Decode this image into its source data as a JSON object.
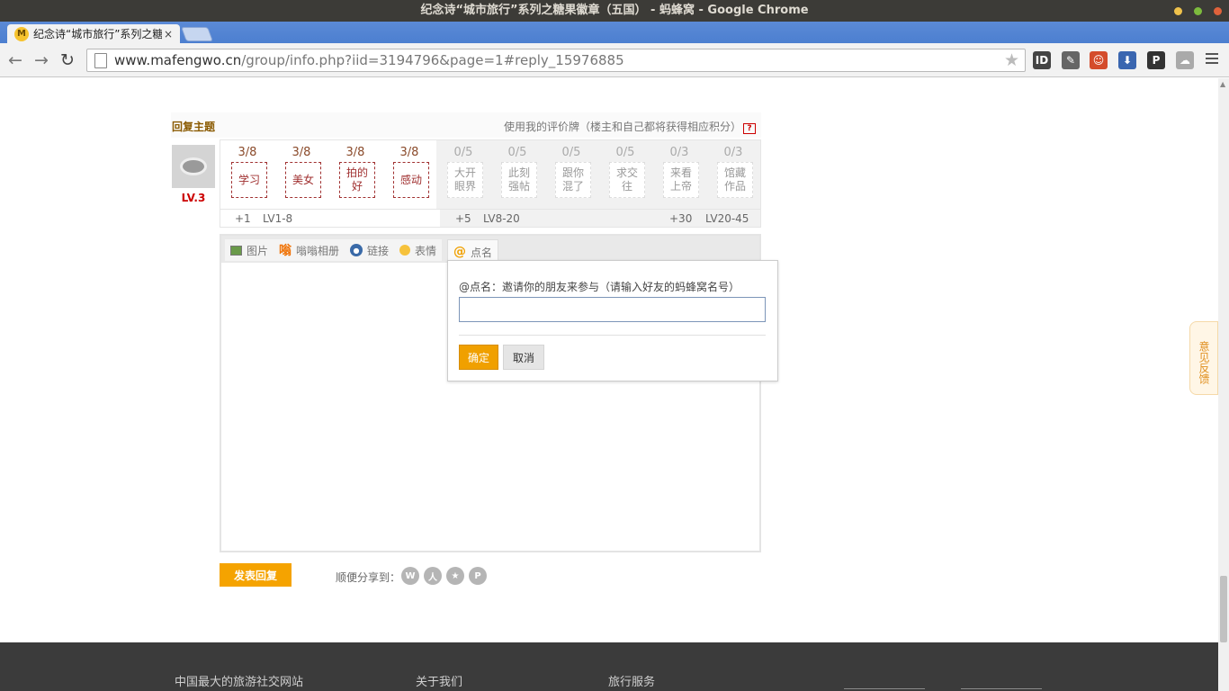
{
  "window": {
    "title": "纪念诗“城市旅行”系列之糖果徽章（五国） - 蚂蜂窝 - Google Chrome",
    "tab_title": "纪念诗“城市旅行”系列之糖",
    "tab_close": "×",
    "favicon_letter": "M"
  },
  "toolbar": {
    "url_host": "www.mafengwo.cn",
    "url_rest": "/group/info.php?iid=3194796&page=1#reply_15976885",
    "back": "←",
    "forward": "→",
    "reload": "↻",
    "star": "★",
    "extensions": [
      {
        "name": "readability-icon",
        "label": "ID",
        "color": "#444444"
      },
      {
        "name": "evernote-icon",
        "label": "✎",
        "color": "#666666"
      },
      {
        "name": "santa-icon",
        "label": "☺",
        "color": "#d44c2c"
      },
      {
        "name": "download-icon",
        "label": "⬇",
        "color": "#3a66b0"
      },
      {
        "name": "pocket-icon",
        "label": "P",
        "color": "#333333"
      },
      {
        "name": "ghost-icon",
        "label": "☁",
        "color": "#aaaaaa"
      }
    ]
  },
  "reply": {
    "heading": "回复主题",
    "rating_hint": "使用我的评价牌（楼主和自己都将获得相应积分）",
    "help_icon": "?",
    "user_level": "LV.3",
    "free_cards": [
      {
        "count": "3/8",
        "label": "学习"
      },
      {
        "count": "3/8",
        "label": "美女"
      },
      {
        "count": "3/8",
        "label": "拍的好"
      },
      {
        "count": "3/8",
        "label": "感动"
      }
    ],
    "locked_cards": [
      {
        "count": "0/5",
        "label": "大开眼界"
      },
      {
        "count": "0/5",
        "label": "此刻强帖"
      },
      {
        "count": "0/5",
        "label": "跟你混了"
      },
      {
        "count": "0/5",
        "label": "求交往"
      },
      {
        "count": "0/3",
        "label": "来看上帝"
      },
      {
        "count": "0/3",
        "label": "馆藏作品"
      }
    ],
    "tiers": [
      {
        "points": "+1",
        "levels": "LV1-8"
      },
      {
        "points": "+5",
        "levels": "LV8-20"
      },
      {
        "points": "+30",
        "levels": "LV20-45"
      }
    ]
  },
  "editor": {
    "tools": [
      {
        "name": "image",
        "label": "图片"
      },
      {
        "name": "album",
        "label": "嗡嗡相册"
      },
      {
        "name": "link",
        "label": "链接"
      },
      {
        "name": "emoji",
        "label": "表情"
      },
      {
        "name": "mention",
        "label": "点名"
      }
    ]
  },
  "mention_popup": {
    "title": "@点名：邀请你的朋友来参与（请输入好友的蚂蜂窝名号）",
    "input_value": "",
    "confirm": "确定",
    "cancel": "取消"
  },
  "feedback_tab": "意见反馈",
  "actions": {
    "submit": "发表回复",
    "share_label": "顺便分享到："
  },
  "footer": {
    "links": [
      "中国最大的旅游社交网站",
      "关于我们",
      "旅行服务"
    ]
  },
  "colors": {
    "accent": "#f5a300",
    "brand_red": "#cc0000",
    "tabstrip": "#4c7fd0"
  }
}
